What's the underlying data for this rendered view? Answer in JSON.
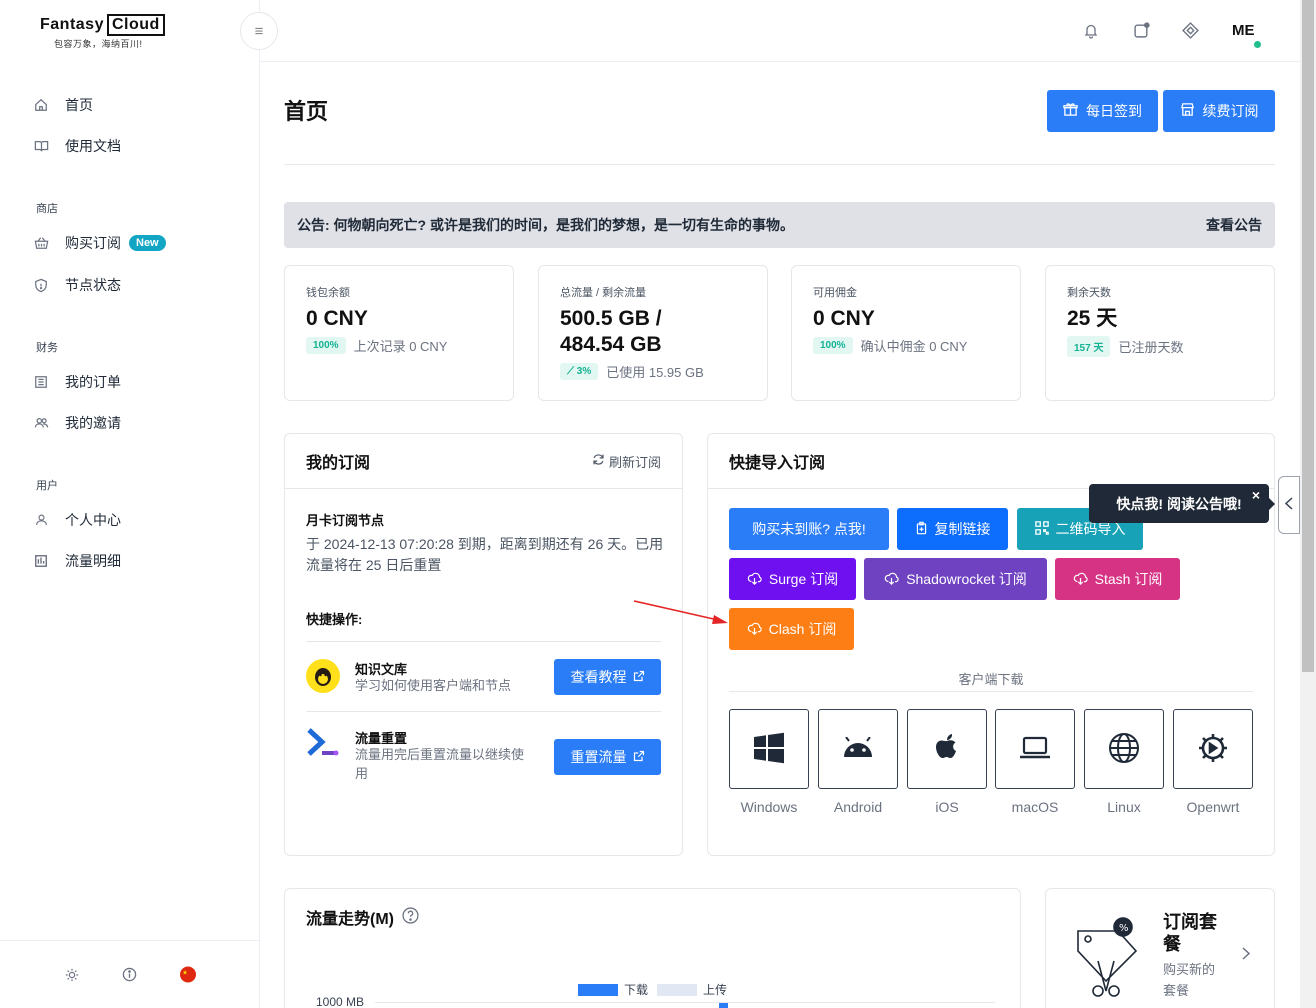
{
  "brand": {
    "name_a": "Fantasy",
    "name_b": "Cloud",
    "slogan": "包容万象，海纳百川!"
  },
  "sidebar": {
    "items": [
      {
        "label": "首页",
        "icon": "home-icon"
      },
      {
        "label": "使用文档",
        "icon": "book-icon"
      }
    ],
    "sections": [
      {
        "title": "商店",
        "items": [
          {
            "label": "购买订阅",
            "icon": "basket-icon",
            "badge": "New"
          },
          {
            "label": "节点状态",
            "icon": "shield-icon"
          }
        ]
      },
      {
        "title": "财务",
        "items": [
          {
            "label": "我的订单",
            "icon": "list-icon"
          },
          {
            "label": "我的邀请",
            "icon": "users-icon"
          }
        ]
      },
      {
        "title": "用户",
        "items": [
          {
            "label": "个人中心",
            "icon": "user-icon"
          },
          {
            "label": "流量明细",
            "icon": "chart-icon"
          }
        ]
      }
    ]
  },
  "header": {
    "user_initials": "ME"
  },
  "page": {
    "title": "首页",
    "checkin_label": "每日签到",
    "renew_label": "续费订阅",
    "notice_text": "公告: 何物朝向死亡? 或许是我们的时间，是我们的梦想，是一切有生命的事物。",
    "notice_link": "查看公告"
  },
  "stats": [
    {
      "label": "钱包余额",
      "value": "0 CNY",
      "chip": "100%",
      "sub": "上次记录 0 CNY"
    },
    {
      "label": "总流量 / 剩余流量",
      "value": "500.5 GB / 484.54 GB",
      "chip": "3%",
      "sub": "已使用 15.95 GB"
    },
    {
      "label": "可用佣金",
      "value": "0 CNY",
      "chip": "100%",
      "sub": "确认中佣金 0 CNY"
    },
    {
      "label": "剩余天数",
      "value": "25 天",
      "chip": "157 天",
      "sub": "已注册天数"
    }
  ],
  "subscription": {
    "title": "我的订阅",
    "refresh": "刷新订阅",
    "plan_name": "月卡订阅节点",
    "plan_desc": "于 2024-12-13 07:20:28 到期，距离到期还有 26 天。已用流量将在 25 日后重置",
    "quick_ops_title": "快捷操作:",
    "ops": [
      {
        "title": "知识文库",
        "desc": "学习如何使用客户端和节点",
        "button": "查看教程"
      },
      {
        "title": "流量重置",
        "desc": "流量用完后重置流量以继续使用",
        "button": "重置流量"
      }
    ]
  },
  "quick_import": {
    "title": "快捷导入订阅",
    "buttons": [
      {
        "label": "购买未到账? 点我!",
        "color": "#2a7df6"
      },
      {
        "label": "复制链接",
        "color": "#0d6efd"
      },
      {
        "label": "二维码导入",
        "color": "#17a2b8"
      },
      {
        "label": "Surge 订阅",
        "color": "#6f10f1"
      },
      {
        "label": "Shadowrocket 订阅",
        "color": "#6f42c1"
      },
      {
        "label": "Stash 订阅",
        "color": "#d63384"
      },
      {
        "label": "Clash 订阅",
        "color": "#fd7e14"
      }
    ],
    "client_download": "客户端下载",
    "clients": [
      "Windows",
      "Android",
      "iOS",
      "macOS",
      "Linux",
      "Openwrt"
    ]
  },
  "tooltip": {
    "text": "快点我! 阅读公告哦!",
    "close": "×"
  },
  "traffic": {
    "title": "流量走势(M)",
    "legend_download": "下载",
    "legend_upload": "上传",
    "y_top_label": "1000 MB",
    "download_color": "#2a7df6",
    "upload_color": "#e2e8f3"
  },
  "plan_card": {
    "title": "订阅套餐",
    "desc": "购买新的套餐"
  }
}
